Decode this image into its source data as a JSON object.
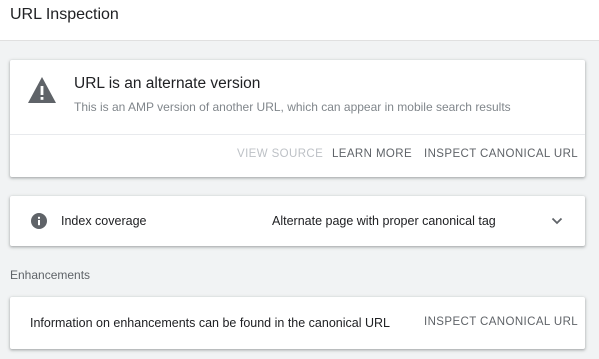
{
  "header": {
    "title": "URL Inspection"
  },
  "status_card": {
    "icon": "warning-icon",
    "title": "URL is an alternate version",
    "description": "This is an AMP version of another URL, which can appear in mobile search results",
    "actions": {
      "view_source": "VIEW SOURCE",
      "learn_more": "LEARN MORE",
      "inspect_canonical": "INSPECT CANONICAL URL"
    }
  },
  "coverage_card": {
    "icon": "info-icon",
    "label": "Index coverage",
    "value": "Alternate page with proper canonical tag",
    "expand_icon": "chevron-down-icon"
  },
  "enhancements": {
    "section_label": "Enhancements",
    "text": "Information on enhancements can be found in the canonical URL",
    "action": "INSPECT CANONICAL URL"
  },
  "colors": {
    "page_bg": "#f1f3f4",
    "card_bg": "#ffffff",
    "icon_gray": "#5f6368",
    "disabled_text": "#bdc1c6"
  }
}
